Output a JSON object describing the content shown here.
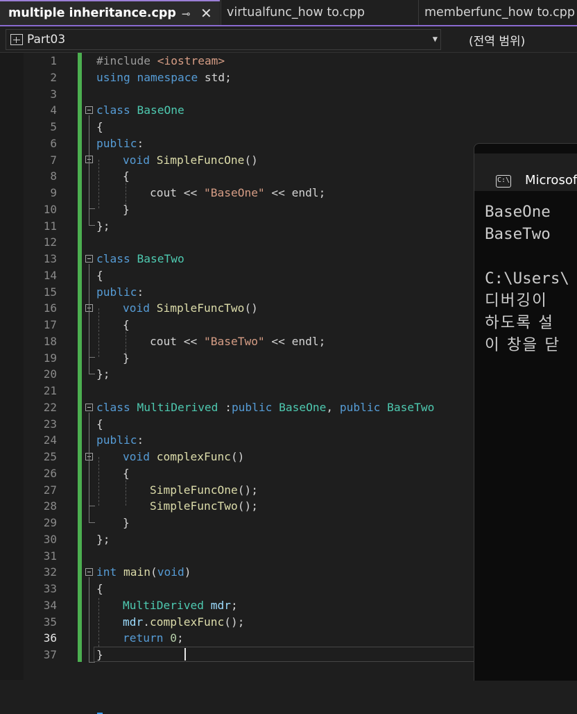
{
  "tabs": [
    {
      "label": "multiple inheritance.cpp",
      "active": true
    },
    {
      "label": "virtualfunc_how to.cpp",
      "active": false
    },
    {
      "label": "memberfunc_how to.cpp",
      "active": false
    }
  ],
  "icons": {
    "pin": "pin-icon",
    "close": "close-icon",
    "scope": "class-scope-icon",
    "console": "console-app-icon"
  },
  "navbar": {
    "project": "Part03",
    "scope": "(전역 범위)"
  },
  "editor": {
    "current_line": 36,
    "lines": [
      {
        "n": "1"
      },
      {
        "n": "2"
      },
      {
        "n": "3"
      },
      {
        "n": "4"
      },
      {
        "n": "5"
      },
      {
        "n": "6"
      },
      {
        "n": "7"
      },
      {
        "n": "8"
      },
      {
        "n": "9"
      },
      {
        "n": "10"
      },
      {
        "n": "11"
      },
      {
        "n": "12"
      },
      {
        "n": "13"
      },
      {
        "n": "14"
      },
      {
        "n": "15"
      },
      {
        "n": "16"
      },
      {
        "n": "17"
      },
      {
        "n": "18"
      },
      {
        "n": "19"
      },
      {
        "n": "20"
      },
      {
        "n": "21"
      },
      {
        "n": "22"
      },
      {
        "n": "23"
      },
      {
        "n": "24"
      },
      {
        "n": "25"
      },
      {
        "n": "26"
      },
      {
        "n": "27"
      },
      {
        "n": "28"
      },
      {
        "n": "29"
      },
      {
        "n": "30"
      },
      {
        "n": "31"
      },
      {
        "n": "32"
      },
      {
        "n": "33"
      },
      {
        "n": "34"
      },
      {
        "n": "35"
      },
      {
        "n": "36"
      },
      {
        "n": "37"
      }
    ],
    "code": {
      "l1a": "#include ",
      "l1b": "<iostream>",
      "l2a": "using namespace",
      "l2b": " std;",
      "l4a": "class",
      "l4b": " BaseOne",
      "l5": "{",
      "l6a": "public",
      "l6b": ":",
      "l7a": "void",
      "l7b": " SimpleFuncOne",
      "l7c": "()",
      "l8": "{",
      "l9a": "cout << ",
      "l9b": "\"BaseOne\"",
      "l9c": " << endl;",
      "l10": "}",
      "l11": "};",
      "l13a": "class",
      "l13b": " BaseTwo",
      "l14": "{",
      "l15a": "public",
      "l15b": ":",
      "l16a": "void",
      "l16b": " SimpleFuncTwo",
      "l16c": "()",
      "l17": "{",
      "l18a": "cout << ",
      "l18b": "\"BaseTwo\"",
      "l18c": " << endl;",
      "l19": "}",
      "l20": "};",
      "l22a": "class",
      "l22b": " MultiDerived ",
      "l22c": ":",
      "l22d": "public",
      "l22e": " BaseOne",
      "l22f": ", ",
      "l22g": "public",
      "l22h": " BaseTwo",
      "l23": "{",
      "l24a": "public",
      "l24b": ":",
      "l25a": "void",
      "l25b": " complexFunc",
      "l25c": "()",
      "l26": "{",
      "l27a": "SimpleFuncOne",
      "l27b": "();",
      "l28a": "SimpleFuncTwo",
      "l28b": "();",
      "l29": "}",
      "l30": "};",
      "l32a": "int",
      "l32b": " main",
      "l32c": "(",
      "l32d": "void",
      "l32e": ")",
      "l33": "{",
      "l34a": "MultiDerived",
      "l34b": " mdr",
      "l34c": ";",
      "l35a": "mdr",
      "l35b": ".",
      "l35c": "complexFunc",
      "l35d": "();",
      "l36a": "return",
      "l36b": " ",
      "l36c": "0",
      "l36d": ";",
      "l37": "}"
    }
  },
  "console": {
    "title": "Microsof",
    "output": [
      "BaseOne",
      "BaseTwo",
      "",
      "C:\\Users\\",
      "디버깅이",
      "하도록 설",
      "이 창을 닫"
    ]
  }
}
